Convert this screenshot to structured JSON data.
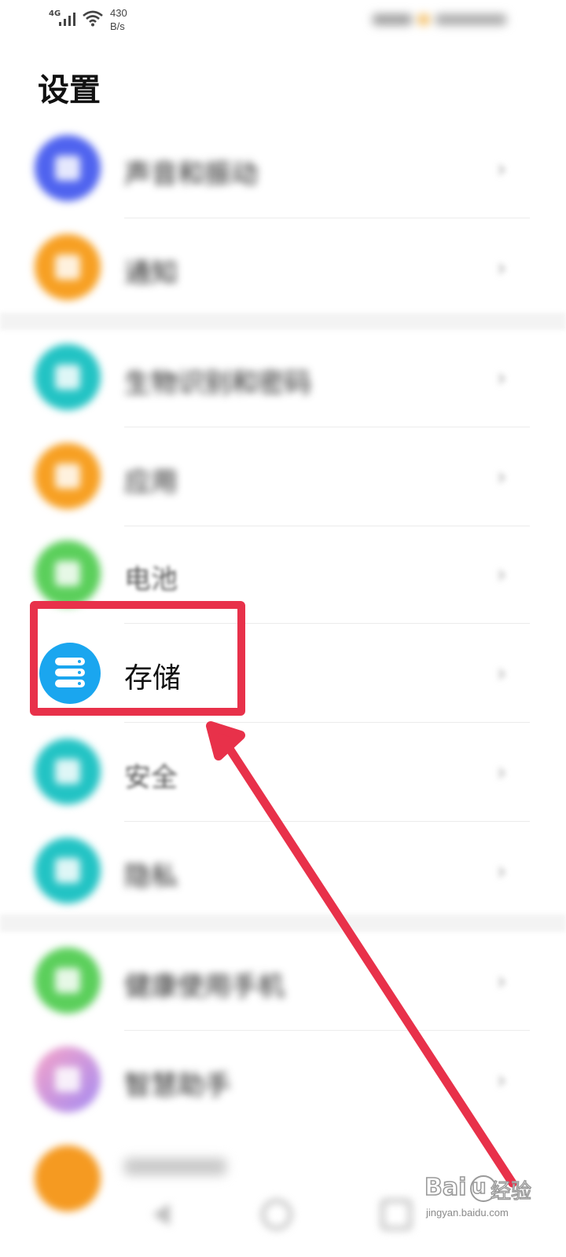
{
  "status_bar": {
    "network": "4G",
    "speed_value": "430",
    "speed_unit": "B/s"
  },
  "header": {
    "title": "设置"
  },
  "settings_items": [
    {
      "label": "声音和振动",
      "icon": "speaker-icon",
      "color": "#4f63ef"
    },
    {
      "label": "通知",
      "icon": "bell-icon",
      "color": "#f7a023"
    },
    {
      "label": "生物识别和密码",
      "icon": "key-icon",
      "color": "#22c3c4"
    },
    {
      "label": "应用",
      "icon": "apps-grid-icon",
      "color": "#f7a023"
    },
    {
      "label": "电池",
      "icon": "battery-icon",
      "color": "#5bcf5b"
    },
    {
      "label": "存储",
      "icon": "storage-icon",
      "color": "#1aa6ef"
    },
    {
      "label": "安全",
      "icon": "shield-icon",
      "color": "#22c3c4"
    },
    {
      "label": "隐私",
      "icon": "privacy-icon",
      "color": "#22c3c4"
    },
    {
      "label": "健康使用手机",
      "icon": "hourglass-icon",
      "color": "#5bcf5b"
    },
    {
      "label": "智慧助手",
      "icon": "assistant-icon",
      "color": "#c58af0"
    }
  ],
  "annotation": {
    "color": "#e8314a"
  },
  "watermark": {
    "brand": "Bai",
    "brand_suffix": "u",
    "cn": "经验",
    "url": "jingyan.baidu.com"
  },
  "nav": [
    "back-icon",
    "home-icon",
    "recents-icon"
  ]
}
